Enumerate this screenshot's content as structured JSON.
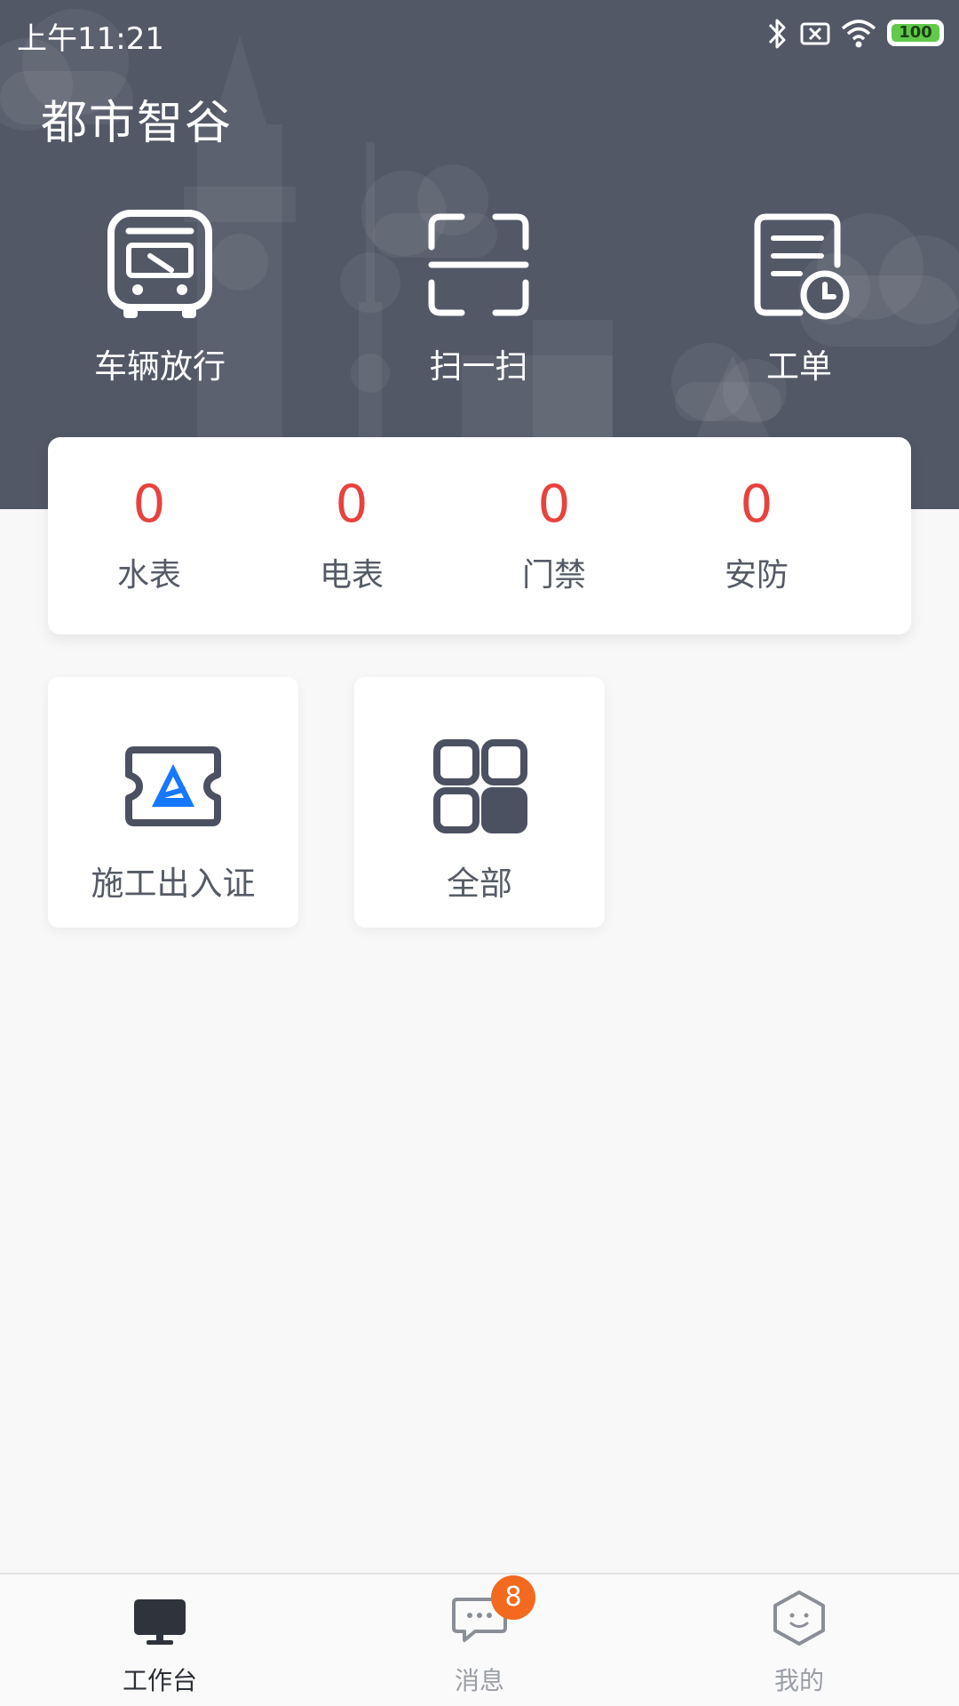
{
  "status_bar": {
    "time": "上午11:21",
    "battery_level": "100",
    "icons": [
      "bluetooth-icon",
      "no-sim-icon",
      "wifi-icon",
      "battery-icon"
    ]
  },
  "header": {
    "title": "都市智谷",
    "background_color": "#525866"
  },
  "quick_actions": [
    {
      "label": "车辆放行",
      "icon": "bus-icon"
    },
    {
      "label": "扫一扫",
      "icon": "scan-icon"
    },
    {
      "label": "工单",
      "icon": "work-order-icon"
    }
  ],
  "stats": [
    {
      "value": "0",
      "label": "水表"
    },
    {
      "value": "0",
      "label": "电表"
    },
    {
      "value": "0",
      "label": "门禁"
    },
    {
      "value": "0",
      "label": "安防"
    }
  ],
  "stats_value_color": "#e8423f",
  "apps": [
    {
      "label": "施工出入证",
      "icon": "construction-pass-icon"
    },
    {
      "label": "全部",
      "icon": "all-apps-icon"
    }
  ],
  "tab_bar": {
    "items": [
      {
        "label": "工作台",
        "icon": "desktop-monitor-icon",
        "active": true
      },
      {
        "label": "消息",
        "icon": "message-bubble-icon",
        "active": false,
        "badge": "8"
      },
      {
        "label": "我的",
        "icon": "profile-hexagon-icon",
        "active": false
      }
    ],
    "badge_color": "#f3691f"
  }
}
